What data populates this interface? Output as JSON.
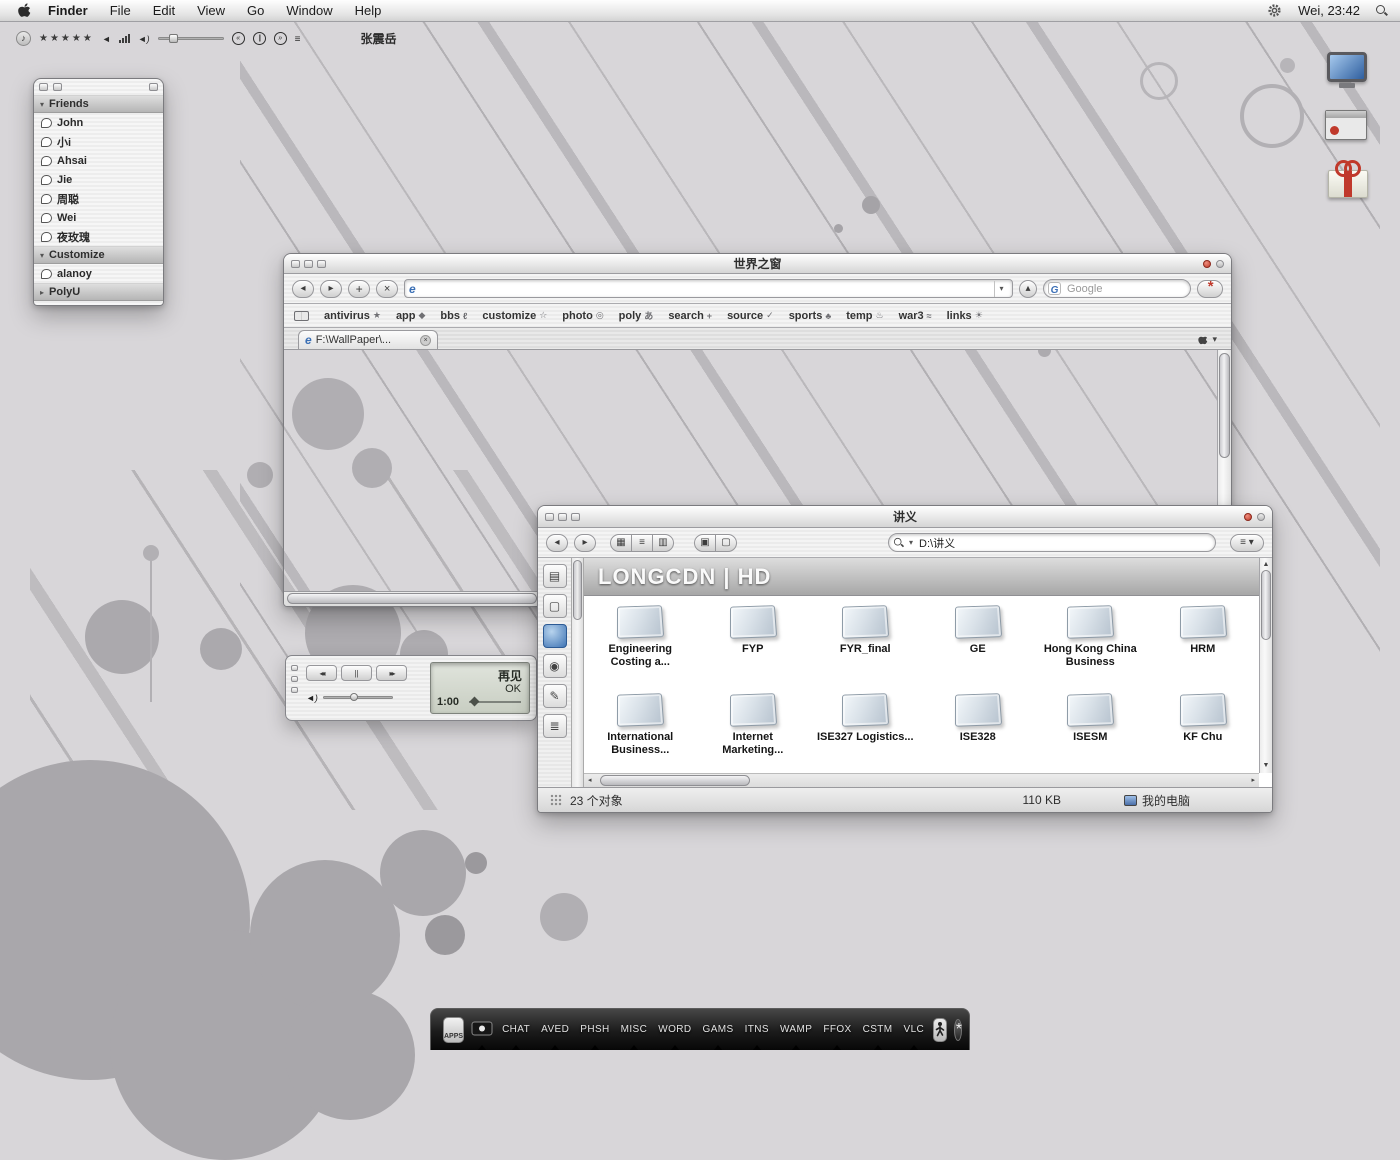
{
  "colors": {
    "close_red": "#c0392b",
    "accent_blue": "#3a6fb5"
  },
  "menu_bar": {
    "items": [
      "Finder",
      "File",
      "Edit",
      "View",
      "Go",
      "Window",
      "Help"
    ],
    "clock": "Wei, 23:42"
  },
  "music_bar": {
    "rating": "★★★★★",
    "artist": "张震岳"
  },
  "buddy_list": {
    "rows": [
      {
        "label": "Friends",
        "kind": "header"
      },
      {
        "label": "John",
        "kind": "buddy"
      },
      {
        "label": "小i",
        "kind": "buddy"
      },
      {
        "label": "Ahsai",
        "kind": "buddy"
      },
      {
        "label": "Jie",
        "kind": "buddy"
      },
      {
        "label": "周聪",
        "kind": "buddy"
      },
      {
        "label": "Wei",
        "kind": "buddy"
      },
      {
        "label": "夜玫瑰",
        "kind": "buddy"
      },
      {
        "label": "Customize",
        "kind": "header"
      },
      {
        "label": "alanoy",
        "kind": "buddy"
      },
      {
        "label": "PolyU",
        "kind": "header"
      }
    ]
  },
  "browser": {
    "title": "世界之窗",
    "address_value": "",
    "search_placeholder": "Google",
    "tab_label": "F:\\WallPaper\\...",
    "bookmarks": [
      {
        "label": "antivirus",
        "glyph": "★"
      },
      {
        "label": "app",
        "glyph": "◆"
      },
      {
        "label": "bbs",
        "glyph": "ℓ"
      },
      {
        "label": "customize",
        "glyph": "☆"
      },
      {
        "label": "photo",
        "glyph": "◎"
      },
      {
        "label": "poly",
        "glyph": "あ"
      },
      {
        "label": "search",
        "glyph": "+"
      },
      {
        "label": "source",
        "glyph": "✓"
      },
      {
        "label": "sports",
        "glyph": "♣"
      },
      {
        "label": "temp",
        "glyph": "♨"
      },
      {
        "label": "war3",
        "glyph": "≈"
      },
      {
        "label": "links",
        "glyph": "☀"
      }
    ]
  },
  "file_manager": {
    "title": "讲义",
    "search_value": "D:\\讲义",
    "banner": "LONGCDN | HD",
    "folders": [
      "Engineering Costing a...",
      "FYP",
      "FYR_final",
      "GE",
      "Hong Kong China Business",
      "HRM",
      "International Business...",
      "Internet Marketing...",
      "ISE327 Logistics...",
      "ISE328",
      "ISESM",
      "KF Chu"
    ],
    "status": {
      "count": "23 个对象",
      "size": "110 KB",
      "location": "我的电脑"
    }
  },
  "media_player": {
    "track": "再见",
    "state": "OK",
    "time": "1:00"
  },
  "dock": {
    "apps_label": "APPS",
    "items": [
      "CHAT",
      "AVED",
      "PHSH",
      "MISC",
      "WORD",
      "GAMS",
      "ITNS",
      "WAMP",
      "FFOX",
      "CSTM",
      "VLC"
    ]
  }
}
